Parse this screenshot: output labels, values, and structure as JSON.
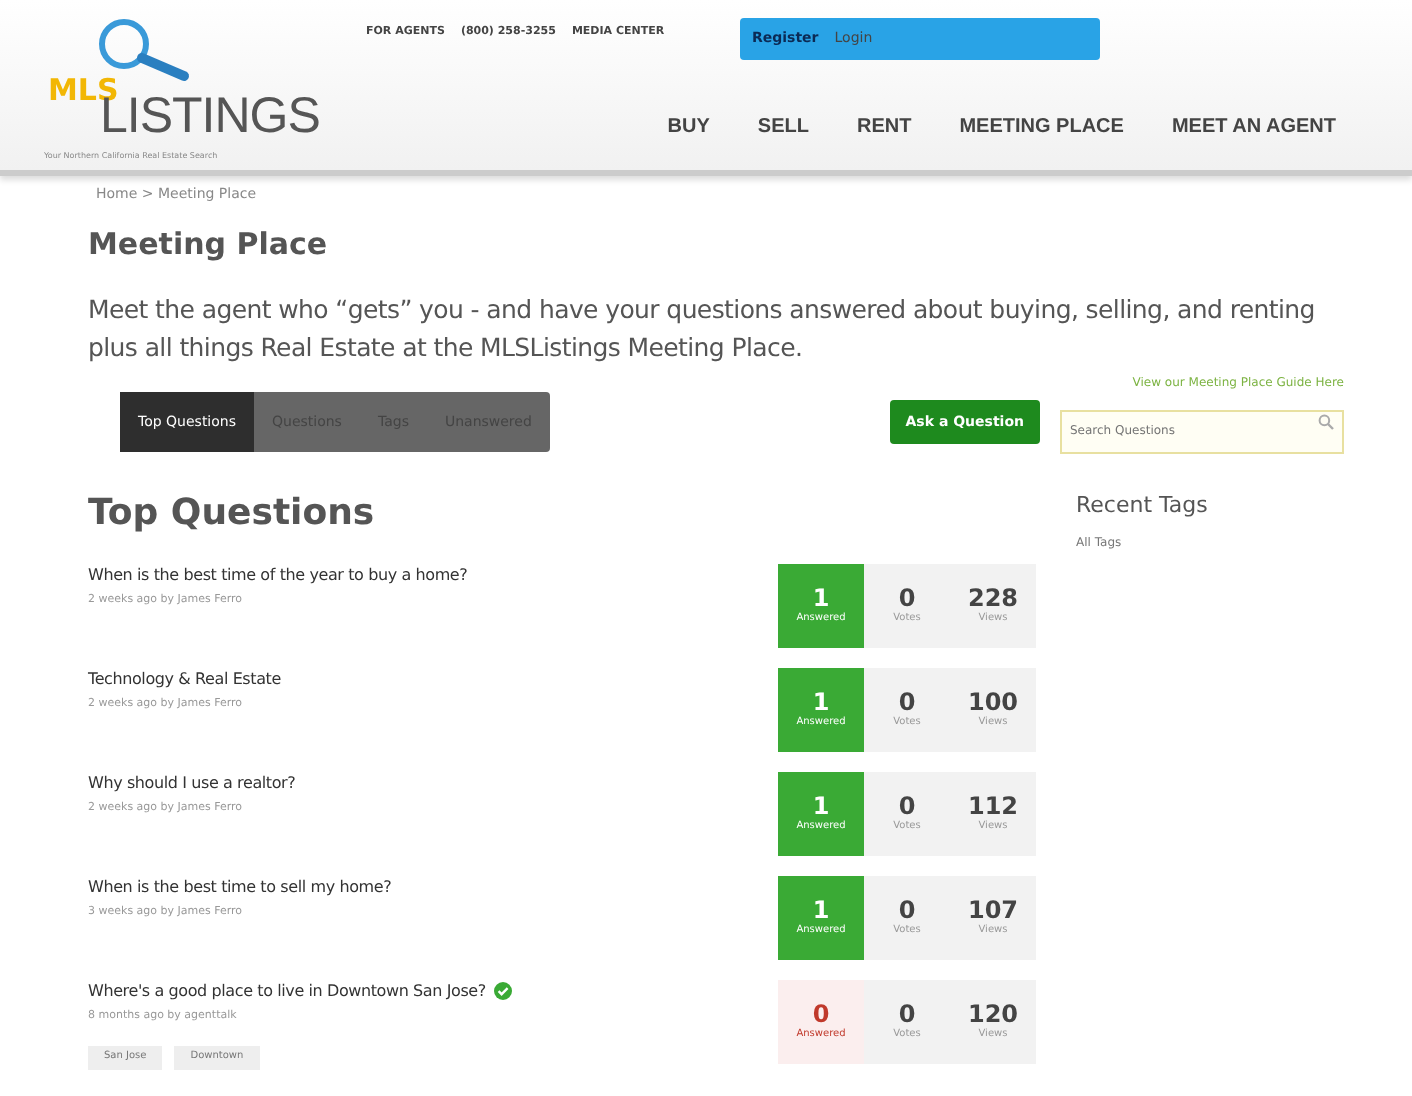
{
  "header": {
    "logo": {
      "mark": "MLS",
      "name": "LISTINGS",
      "tagline": "Your Northern California Real Estate Search"
    },
    "top_links": [
      "FOR AGENTS",
      "(800) 258-3255",
      "MEDIA CENTER"
    ],
    "account_links": [
      "Register",
      "Login"
    ],
    "nav": [
      {
        "label": "BUY"
      },
      {
        "label": "SELL"
      },
      {
        "label": "RENT"
      },
      {
        "label": "MEETING PLACE"
      },
      {
        "label": "MEET AN AGENT"
      }
    ]
  },
  "breadcrumb": "Home > Meeting Place",
  "page_title": "Meeting Place",
  "intro": "Meet the agent who “gets” you - and have your questions answered  about buying, selling, and renting plus all things Real Estate at the MLSListings Meeting Place.",
  "guide_link": "View our Meeting Place Guide Here",
  "tabs": [
    {
      "label": "Top Questions",
      "selected": true
    },
    {
      "label": "Questions",
      "selected": false
    },
    {
      "label": "Tags",
      "selected": false
    },
    {
      "label": "Unanswered",
      "selected": false
    }
  ],
  "ask_button": "Ask a Question",
  "search": {
    "placeholder": "Search Questions"
  },
  "section_title": "Top Questions",
  "questions": [
    {
      "title": "When is the best time of the year to buy a home?",
      "meta": "2 weeks ago by James Ferro",
      "answered": true,
      "verified": false,
      "answers": "1",
      "answers_label": "Answered",
      "votes": "0",
      "votes_label": "Votes",
      "views": "228",
      "views_label": "Views"
    },
    {
      "title": "Technology & Real Estate",
      "meta": "2 weeks ago by James Ferro",
      "answered": true,
      "verified": false,
      "answers": "1",
      "answers_label": "Answered",
      "votes": "0",
      "votes_label": "Votes",
      "views": "100",
      "views_label": "Views"
    },
    {
      "title": "Why should I use a realtor?",
      "meta": "2 weeks ago by James Ferro",
      "answered": true,
      "verified": false,
      "answers": "1",
      "answers_label": "Answered",
      "votes": "0",
      "votes_label": "Votes",
      "views": "112",
      "views_label": "Views"
    },
    {
      "title": "When is the best time to sell my home?",
      "meta": "3 weeks ago by James Ferro",
      "answered": true,
      "verified": false,
      "answers": "1",
      "answers_label": "Answered",
      "votes": "0",
      "votes_label": "Votes",
      "views": "107",
      "views_label": "Views"
    },
    {
      "title": "Where's a good place to live in Downtown San Jose?",
      "meta": "8 months ago by agenttalk",
      "answered": false,
      "verified": true,
      "answers": "0",
      "answers_label": "Answered",
      "votes": "0",
      "votes_label": "Votes",
      "views": "120",
      "views_label": "Views",
      "tags": [
        "San Jose",
        "Downtown"
      ]
    }
  ],
  "sidebar": {
    "title": "Recent Tags",
    "links": [
      "All Tags"
    ]
  }
}
